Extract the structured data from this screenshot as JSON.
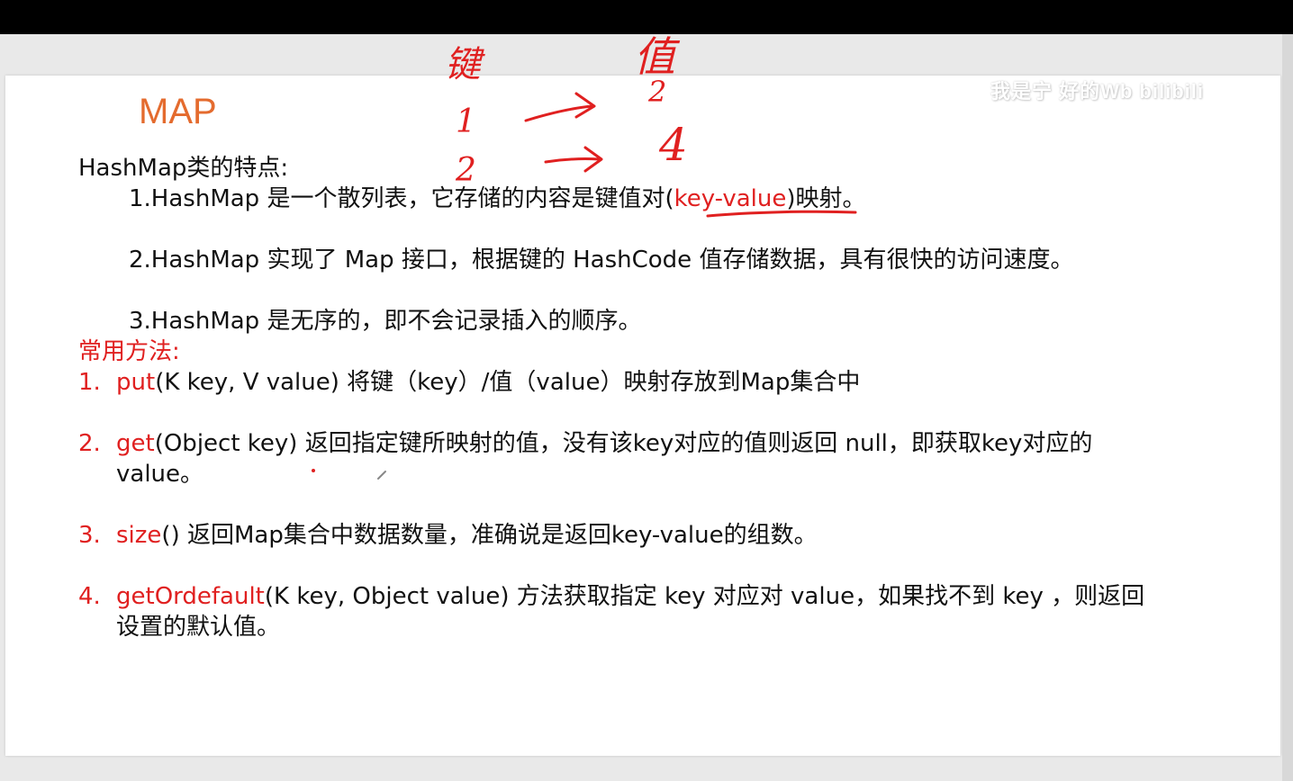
{
  "slide": {
    "title": "MAP",
    "watermark": "我是宁 好的Wb bilibili",
    "colors": {
      "title": "#e46b2e",
      "accent": "#e02020",
      "text": "#111111"
    }
  },
  "hashmap": {
    "heading": "HashMap类的特点:",
    "points": [
      {
        "prefix": "1.HashMap 是一个散列表，它存储的内容是键值对(",
        "highlight": "key-value",
        "suffix": ")映射。"
      },
      {
        "text": "2.HashMap 实现了 Map 接口，根据键的 HashCode 值存储数据，具有很快的访问速度。"
      },
      {
        "text": "3.HashMap 是无序的，即不会记录插入的顺序。"
      }
    ]
  },
  "methods": {
    "heading": "常用方法:",
    "items": [
      {
        "num": "1.",
        "name": "put",
        "desc": "(K key, V value) 将键（key）/值（value）映射存放到Map集合中",
        "desc2": ""
      },
      {
        "num": "2.",
        "name": "get",
        "desc": "(Object key) 返回指定键所映射的值，没有该key对应的值则返回 null，即获取key对应的",
        "desc2": "value。"
      },
      {
        "num": "3.",
        "name": "size",
        "desc": "()  返回Map集合中数据数量，准确说是返回key-value的组数。",
        "desc2": ""
      },
      {
        "num": "4.",
        "name": "getOrdefault",
        "desc": "(K key, Object value) 方法获取指定 key 对应对 value，如果找不到 key ，则返回",
        "desc2": "设置的默认值。"
      }
    ]
  },
  "annotations": {
    "key_label": "键",
    "value_label": "值",
    "rows": [
      {
        "key": "1",
        "value": "2"
      },
      {
        "key": "2",
        "value": "4"
      }
    ]
  }
}
